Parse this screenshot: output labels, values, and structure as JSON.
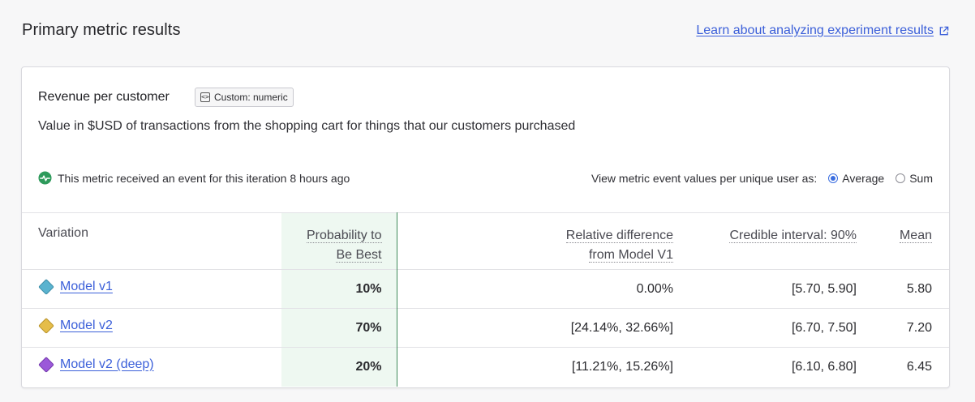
{
  "header": {
    "title": "Primary metric results",
    "learn_link": "Learn about analyzing experiment results",
    "learn_link_icon": "external-link-icon"
  },
  "metric": {
    "name": "Revenue per customer",
    "chip_label": "Custom: numeric",
    "chip_icon": "code-icon",
    "description": "Value in $USD of transactions from the shopping cart for things that our customers purchased",
    "event_status": "This metric received an event for this iteration 8 hours ago",
    "event_status_icon": "pulse-icon",
    "event_status_color": "#2e9a5b"
  },
  "view_as": {
    "label": "View metric event values per unique user as:",
    "options": [
      {
        "label": "Average",
        "selected": true
      },
      {
        "label": "Sum",
        "selected": false
      }
    ]
  },
  "table": {
    "columns": {
      "variation": "Variation",
      "probability_line1": "Probability to",
      "probability_line2": "Be Best",
      "relative_line1": "Relative difference",
      "relative_line2": "from Model V1",
      "credible_interval": "Credible interval: 90%",
      "mean": "Mean"
    },
    "rows": [
      {
        "name": "Model v1",
        "color": "#5ab3cf",
        "probability": "10%",
        "relative": "0.00%",
        "interval": "[5.70, 5.90]",
        "mean": "5.80"
      },
      {
        "name": "Model v2",
        "color": "#e5bd4a",
        "probability": "70%",
        "relative": "[24.14%, 32.66%]",
        "interval": "[6.70, 7.50]",
        "mean": "7.20"
      },
      {
        "name": "Model v2 (deep)",
        "color": "#9b59d9",
        "probability": "20%",
        "relative": "[11.21%, 15.26%]",
        "interval": "[6.10, 6.80]",
        "mean": "6.45"
      }
    ]
  },
  "colors": {
    "accent": "#3b5fd9",
    "best_column_bg": "#eef8f1",
    "best_column_border": "#3f8a5a"
  }
}
